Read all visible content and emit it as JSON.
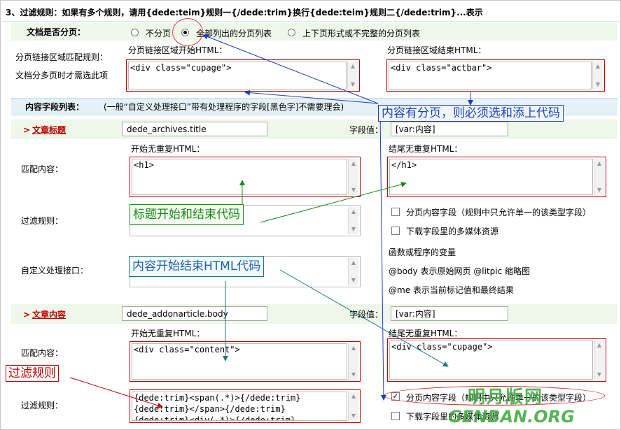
{
  "header": {
    "rule_text": "3、过滤规则：如果有多个规则，请用{dede:teim}规则一{/dede:trim}换行{dede:teim}规则二{/dede:trim}...表示"
  },
  "paging": {
    "label": "文档是否分页：",
    "options": [
      "不分页",
      "全部列出的分页列表",
      "上下页形式或不完整的分页列表"
    ],
    "selected_index": 1
  },
  "paging_links": {
    "label_line1": "分页链接区域匹配规则：",
    "label_line2": "文档分多页时才需选此项",
    "start_label": "分页链接区域开始HTML：",
    "start_value": "<div class=\"cupage\">",
    "end_label": "分页链接区域结束HTML：",
    "end_value": "<div class=\"actbar\">"
  },
  "fields_section": {
    "title": "内容字段列表：",
    "desc": "(一般“自定义处理接口”带有处理程序的字段[黑色字]不需要理会)"
  },
  "title_field": {
    "name": "文章标题",
    "db_field": "dede_archives.title",
    "value_label": "字段值：",
    "value": "[var:内容]",
    "start_label": "开始无重复HTML：",
    "start_value": "<h1>",
    "end_label": "结尾无重复HTML：",
    "end_value": "</h1>",
    "match_label": "匹配内容：",
    "filter_label": "过滤规则：",
    "custom_label": "自定义处理接口：",
    "check_paging": "分页内容字段（规则中只允许单一的该类型字段）",
    "check_media": "下载字段里的多媒体资源",
    "func_title": "函数或程序的变量",
    "func_line1": "@body 表示原始网页  @litpic 缩略图",
    "func_line2": "@me 表示当前标记值和最终结果"
  },
  "body_field": {
    "name": "文章内容",
    "db_field": "dede_addonarticle.body",
    "value_label": "字段值：",
    "value": "[var:内容]",
    "start_label": "开始无重复HTML：",
    "start_value": "<div class=\"content\">",
    "end_label": "结尾无重复HTML：",
    "end_value": "<div class=\"cupage\">",
    "match_label": "匹配内容：",
    "filter_label": "过滤规则：",
    "filter_lines": [
      "{dede:trim}<span(.*)>{/dede:trim}",
      "{dede:trim}</span>{/dede:trim}",
      "{dede:trim}<div(.*)>{/dede:trim}"
    ],
    "check_paging": "分页内容字段（规则中只允许单一的该类型字段）",
    "check_media": "下载字段里的多媒体资源"
  },
  "annotations": {
    "paging_note": "内容有分页，则必须选和添上代码",
    "title_note": "标题开始和结束代码",
    "content_note": "内容开始结束HTML代码",
    "filter_note": "过滤规则"
  },
  "watermark": {
    "text": "明月版网",
    "url": "GENBAN.ORG"
  },
  "colors": {
    "annot_blue": "#1c3fbf",
    "annot_green": "#1a8a1a",
    "annot_red": "#c00000",
    "accent_red": "#c00000"
  }
}
